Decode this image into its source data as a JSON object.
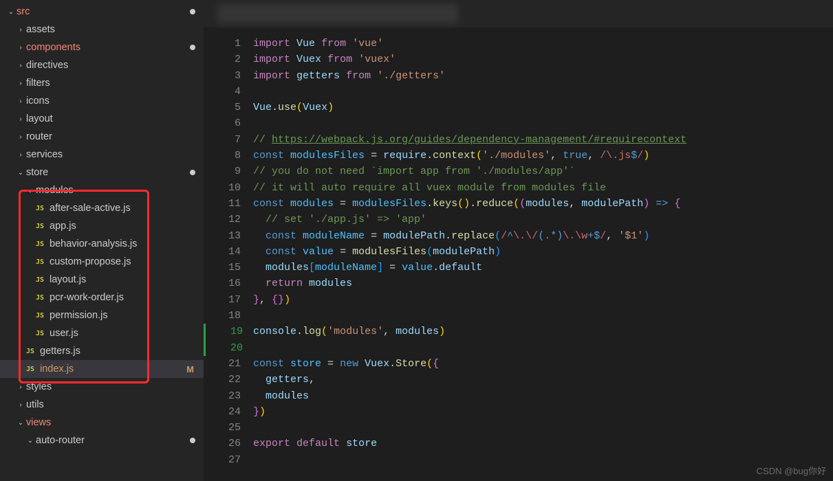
{
  "sidebar": {
    "tree": [
      {
        "depth": 0,
        "type": "folder",
        "open": true,
        "label": "src",
        "git": "err",
        "dot": true
      },
      {
        "depth": 1,
        "type": "folder",
        "open": false,
        "label": "assets"
      },
      {
        "depth": 1,
        "type": "folder",
        "open": false,
        "label": "components",
        "git": "err",
        "dot": true
      },
      {
        "depth": 1,
        "type": "folder",
        "open": false,
        "label": "directives"
      },
      {
        "depth": 1,
        "type": "folder",
        "open": false,
        "label": "filters"
      },
      {
        "depth": 1,
        "type": "folder",
        "open": false,
        "label": "icons"
      },
      {
        "depth": 1,
        "type": "folder",
        "open": false,
        "label": "layout"
      },
      {
        "depth": 1,
        "type": "folder",
        "open": false,
        "label": "router"
      },
      {
        "depth": 1,
        "type": "folder",
        "open": false,
        "label": "services"
      },
      {
        "depth": 1,
        "type": "folder",
        "open": true,
        "label": "store",
        "dot": true
      },
      {
        "depth": 2,
        "type": "folder",
        "open": true,
        "label": "modules"
      },
      {
        "depth": 3,
        "type": "js",
        "label": "after-sale-active.js"
      },
      {
        "depth": 3,
        "type": "js",
        "label": "app.js"
      },
      {
        "depth": 3,
        "type": "js",
        "label": "behavior-analysis.js"
      },
      {
        "depth": 3,
        "type": "js",
        "label": "custom-propose.js"
      },
      {
        "depth": 3,
        "type": "js",
        "label": "layout.js"
      },
      {
        "depth": 3,
        "type": "js",
        "label": "pcr-work-order.js"
      },
      {
        "depth": 3,
        "type": "js",
        "label": "permission.js"
      },
      {
        "depth": 3,
        "type": "js",
        "label": "user.js"
      },
      {
        "depth": 2,
        "type": "js",
        "label": "getters.js"
      },
      {
        "depth": 2,
        "type": "js",
        "label": "index.js",
        "active": true,
        "git": "mod",
        "badge": "M"
      },
      {
        "depth": 1,
        "type": "folder",
        "open": false,
        "label": "styles"
      },
      {
        "depth": 1,
        "type": "folder",
        "open": false,
        "label": "utils"
      },
      {
        "depth": 1,
        "type": "folder",
        "open": true,
        "label": "views",
        "git": "err"
      },
      {
        "depth": 2,
        "type": "folder",
        "open": true,
        "label": "auto-router",
        "dot": true
      }
    ]
  },
  "editor": {
    "lines": [
      {
        "n": 1,
        "tokens": [
          [
            "kw",
            "import"
          ],
          [
            "op",
            " "
          ],
          [
            "var",
            "Vue"
          ],
          [
            "op",
            " "
          ],
          [
            "kw",
            "from"
          ],
          [
            "op",
            " "
          ],
          [
            "str",
            "'vue'"
          ]
        ]
      },
      {
        "n": 2,
        "tokens": [
          [
            "kw",
            "import"
          ],
          [
            "op",
            " "
          ],
          [
            "var",
            "Vuex"
          ],
          [
            "op",
            " "
          ],
          [
            "kw",
            "from"
          ],
          [
            "op",
            " "
          ],
          [
            "str",
            "'vuex'"
          ]
        ]
      },
      {
        "n": 3,
        "tokens": [
          [
            "kw",
            "import"
          ],
          [
            "op",
            " "
          ],
          [
            "var",
            "getters"
          ],
          [
            "op",
            " "
          ],
          [
            "kw",
            "from"
          ],
          [
            "op",
            " "
          ],
          [
            "str",
            "'./getters'"
          ]
        ]
      },
      {
        "n": 4,
        "tokens": []
      },
      {
        "n": 5,
        "tokens": [
          [
            "var",
            "Vue"
          ],
          [
            "punc",
            "."
          ],
          [
            "fn",
            "use"
          ],
          [
            "br1",
            "("
          ],
          [
            "var",
            "Vuex"
          ],
          [
            "br1",
            ")"
          ]
        ]
      },
      {
        "n": 6,
        "tokens": []
      },
      {
        "n": 7,
        "tokens": [
          [
            "cmt",
            "// "
          ],
          [
            "link",
            "https://webpack.js.org/guides/dependency-management/#requirecontext"
          ]
        ]
      },
      {
        "n": 8,
        "tokens": [
          [
            "bool",
            "const"
          ],
          [
            "op",
            " "
          ],
          [
            "const",
            "modulesFiles"
          ],
          [
            "op",
            " = "
          ],
          [
            "var",
            "require"
          ],
          [
            "punc",
            "."
          ],
          [
            "fn",
            "context"
          ],
          [
            "br1",
            "("
          ],
          [
            "str",
            "'./modules'"
          ],
          [
            "punc",
            ", "
          ],
          [
            "bool",
            "true"
          ],
          [
            "punc",
            ", "
          ],
          [
            "re",
            "/"
          ],
          [
            "re",
            "\\."
          ],
          [
            "re",
            "js"
          ],
          [
            "bool",
            "$"
          ],
          [
            "re",
            "/"
          ],
          [
            "br1",
            ")"
          ]
        ]
      },
      {
        "n": 9,
        "tokens": [
          [
            "cmt",
            "// you do not need `import app from './modules/app'`"
          ]
        ]
      },
      {
        "n": 10,
        "tokens": [
          [
            "cmt",
            "// it will auto require all vuex module from modules file"
          ]
        ]
      },
      {
        "n": 11,
        "tokens": [
          [
            "bool",
            "const"
          ],
          [
            "op",
            " "
          ],
          [
            "const",
            "modules"
          ],
          [
            "op",
            " = "
          ],
          [
            "const",
            "modulesFiles"
          ],
          [
            "punc",
            "."
          ],
          [
            "fn",
            "keys"
          ],
          [
            "br1",
            "("
          ],
          [
            "br1",
            ")"
          ],
          [
            "punc",
            "."
          ],
          [
            "fn",
            "reduce"
          ],
          [
            "br1",
            "("
          ],
          [
            "br2",
            "("
          ],
          [
            "var",
            "modules"
          ],
          [
            "punc",
            ", "
          ],
          [
            "var",
            "modulePath"
          ],
          [
            "br2",
            ")"
          ],
          [
            "op",
            " "
          ],
          [
            "bool",
            "=>"
          ],
          [
            "op",
            " "
          ],
          [
            "br2",
            "{"
          ]
        ]
      },
      {
        "n": 12,
        "tokens": [
          [
            "op",
            "  "
          ],
          [
            "cmt",
            "// set './app.js' => 'app'"
          ]
        ]
      },
      {
        "n": 13,
        "tokens": [
          [
            "op",
            "  "
          ],
          [
            "bool",
            "const"
          ],
          [
            "op",
            " "
          ],
          [
            "const",
            "moduleName"
          ],
          [
            "op",
            " = "
          ],
          [
            "var",
            "modulePath"
          ],
          [
            "punc",
            "."
          ],
          [
            "fn",
            "replace"
          ],
          [
            "br3",
            "("
          ],
          [
            "re",
            "/"
          ],
          [
            "bool",
            "^"
          ],
          [
            "re",
            "\\.\\/"
          ],
          [
            "bool",
            "("
          ],
          [
            "re",
            "."
          ],
          [
            "bool",
            "*)"
          ],
          [
            "re",
            "\\.\\w"
          ],
          [
            "bool",
            "+$"
          ],
          [
            "re",
            "/"
          ],
          [
            "punc",
            ", "
          ],
          [
            "str",
            "'$1'"
          ],
          [
            "br3",
            ")"
          ]
        ]
      },
      {
        "n": 14,
        "tokens": [
          [
            "op",
            "  "
          ],
          [
            "bool",
            "const"
          ],
          [
            "op",
            " "
          ],
          [
            "const",
            "value"
          ],
          [
            "op",
            " = "
          ],
          [
            "fn",
            "modulesFiles"
          ],
          [
            "br3",
            "("
          ],
          [
            "var",
            "modulePath"
          ],
          [
            "br3",
            ")"
          ]
        ]
      },
      {
        "n": 15,
        "tokens": [
          [
            "op",
            "  "
          ],
          [
            "var",
            "modules"
          ],
          [
            "br3",
            "["
          ],
          [
            "const",
            "moduleName"
          ],
          [
            "br3",
            "]"
          ],
          [
            "op",
            " = "
          ],
          [
            "const",
            "value"
          ],
          [
            "punc",
            "."
          ],
          [
            "prop",
            "default"
          ]
        ]
      },
      {
        "n": 16,
        "tokens": [
          [
            "op",
            "  "
          ],
          [
            "kw",
            "return"
          ],
          [
            "op",
            " "
          ],
          [
            "var",
            "modules"
          ]
        ]
      },
      {
        "n": 17,
        "tokens": [
          [
            "br2",
            "}"
          ],
          [
            "punc",
            ", "
          ],
          [
            "br2",
            "{"
          ],
          [
            "br2",
            "}"
          ],
          [
            "br1",
            ")"
          ]
        ]
      },
      {
        "n": 18,
        "tokens": []
      },
      {
        "n": 19,
        "mod": true,
        "tokens": [
          [
            "var",
            "console"
          ],
          [
            "punc",
            "."
          ],
          [
            "fn",
            "log"
          ],
          [
            "br1",
            "("
          ],
          [
            "str",
            "'modules'"
          ],
          [
            "punc",
            ", "
          ],
          [
            "var",
            "modules"
          ],
          [
            "br1",
            ")"
          ]
        ]
      },
      {
        "n": 20,
        "mod": true,
        "tokens": []
      },
      {
        "n": 21,
        "tokens": [
          [
            "bool",
            "const"
          ],
          [
            "op",
            " "
          ],
          [
            "const",
            "store"
          ],
          [
            "op",
            " = "
          ],
          [
            "bool",
            "new"
          ],
          [
            "op",
            " "
          ],
          [
            "var",
            "Vuex"
          ],
          [
            "punc",
            "."
          ],
          [
            "fn",
            "Store"
          ],
          [
            "br1",
            "("
          ],
          [
            "br2",
            "{"
          ]
        ]
      },
      {
        "n": 22,
        "tokens": [
          [
            "op",
            "  "
          ],
          [
            "var",
            "getters"
          ],
          [
            "punc",
            ","
          ]
        ]
      },
      {
        "n": 23,
        "tokens": [
          [
            "op",
            "  "
          ],
          [
            "var",
            "modules"
          ]
        ]
      },
      {
        "n": 24,
        "tokens": [
          [
            "br2",
            "}"
          ],
          [
            "br1",
            ")"
          ]
        ]
      },
      {
        "n": 25,
        "tokens": []
      },
      {
        "n": 26,
        "tokens": [
          [
            "kw",
            "export"
          ],
          [
            "op",
            " "
          ],
          [
            "kw",
            "default"
          ],
          [
            "op",
            " "
          ],
          [
            "var",
            "store"
          ]
        ]
      },
      {
        "n": 27,
        "tokens": []
      }
    ]
  },
  "watermark": "CSDN @bug你好"
}
